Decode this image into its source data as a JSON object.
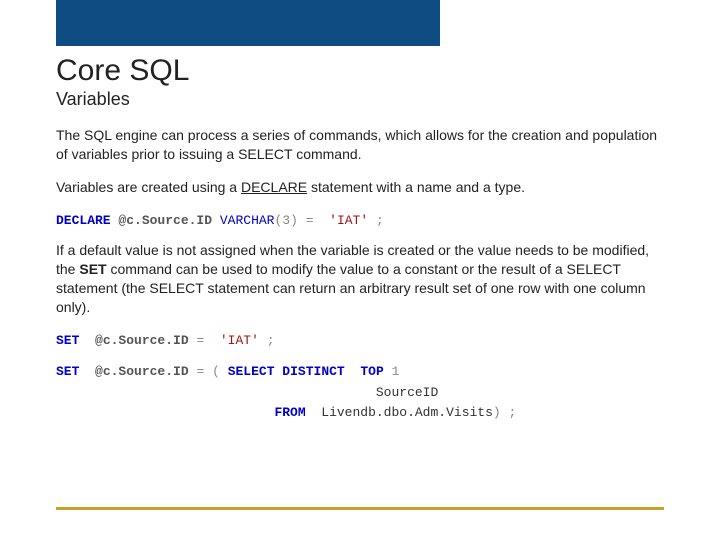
{
  "title": "Core SQL",
  "subtitle": "Variables",
  "para1": "The SQL engine can process a series of commands, which allows for the creation and population of variables prior to issuing a SELECT command.",
  "para2_pre": "Variables are created using a ",
  "para2_kw": "DECLARE",
  "para2_post": " statement with a name and a type.",
  "decl": {
    "kw": "DECLARE",
    "var": "@c.Source.ID",
    "type": "VARCHAR",
    "len": "3",
    "eq": "=",
    "val": "'IAT'",
    "semi": ";"
  },
  "para3_pre": "If a default value is not assigned when the variable is created or the value needs to be modified, the ",
  "para3_kw": "SET",
  "para3_post": " command can be used to modify the value to a constant or the result of a SELECT statement (the SELECT statement can return an arbitrary result set of one row with one column only).",
  "set1": {
    "kw": "SET",
    "var": "@c.Source.ID",
    "eq": "=",
    "val": "'IAT'",
    "semi": ";"
  },
  "set2": {
    "kw": "SET",
    "var": "@c.Source.ID",
    "eq": "=",
    "open": "(",
    "sel": "SELECT DISTINCT",
    "top": "TOP",
    "topn": "1",
    "col": "SourceID",
    "from": "FROM",
    "tbl": "Livendb.dbo.Adm.Visits",
    "close": ")",
    "semi": ";"
  }
}
